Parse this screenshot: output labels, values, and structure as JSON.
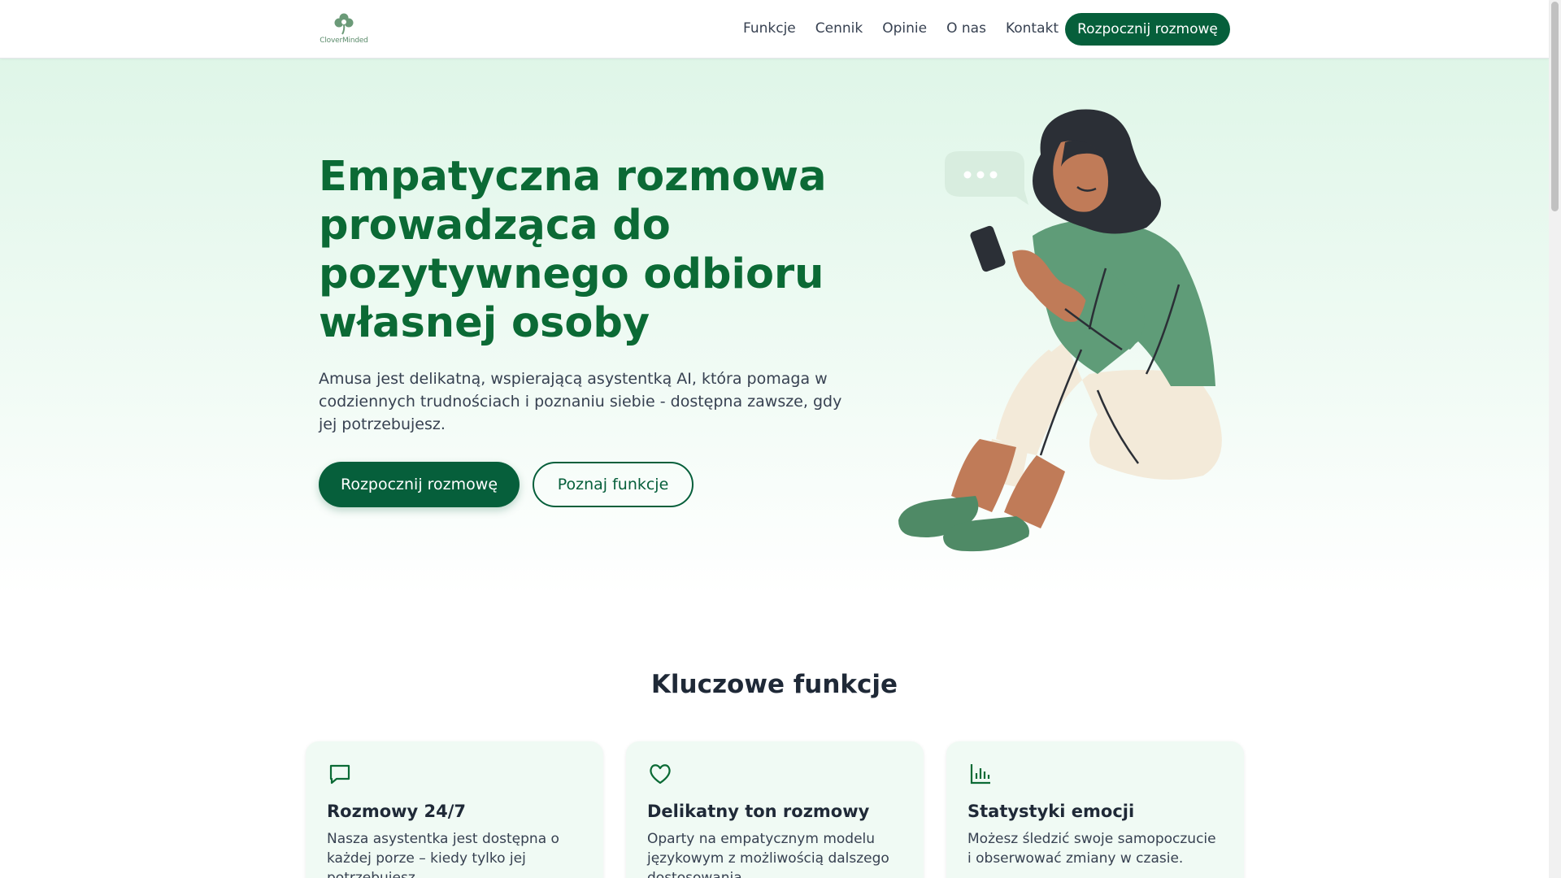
{
  "header": {
    "logo_text": "CloverMinded",
    "nav": [
      {
        "label": "Funkcje"
      },
      {
        "label": "Cennik"
      },
      {
        "label": "Opinie"
      },
      {
        "label": "O nas"
      },
      {
        "label": "Kontakt"
      }
    ],
    "cta_label": "Rozpocznij rozmowę"
  },
  "hero": {
    "title": "Empatyczna rozmowa prowadząca do pozytywnego odbioru własnej osoby",
    "subtitle": "Amusa jest delikatną, wspierającą asystentką AI, która pomaga w codziennych trudnościach i poznaniu siebie - dostępna zawsze, gdy jej potrzebujesz.",
    "primary_button": "Rozpocznij rozmowę",
    "secondary_button": "Poznaj funkcje"
  },
  "features": {
    "title": "Kluczowe funkcje",
    "cards": [
      {
        "icon": "chat-bubble-icon",
        "title": "Rozmowy 24/7",
        "text": "Nasza asystentka jest dostępna o każdej porze – kiedy tylko jej potrzebujesz."
      },
      {
        "icon": "heart-icon",
        "title": "Delikatny ton rozmowy",
        "text": "Oparty na empatycznym modelu językowym z możliwością dalszego dostosowania."
      },
      {
        "icon": "bar-chart-icon",
        "title": "Statystyki emocji",
        "text": "Możesz śledzić swoje samopoczucie i obserwować zmiany w czasie."
      }
    ]
  },
  "colors": {
    "brand": "#065f3b",
    "heading": "#0b6a35",
    "card_bg": "#f0faf4",
    "hero_bg": "#dff6e8"
  }
}
